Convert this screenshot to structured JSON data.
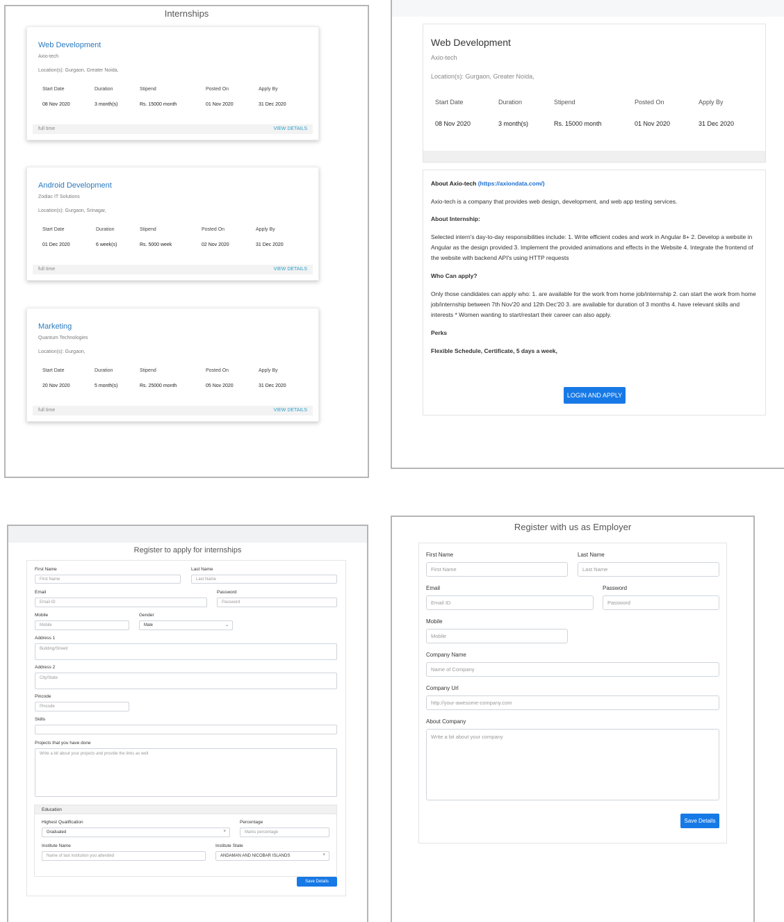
{
  "internships": {
    "title": "Internships",
    "headers": [
      "Start Date",
      "Duration",
      "Stipend",
      "Posted On",
      "Apply By"
    ],
    "cards": [
      {
        "title": "Web Development",
        "company": "Axio-tech",
        "location": "Location(s): Gurgaon, Greater Noida,",
        "start_date": "08 Nov 2020",
        "duration": "3 month(s)",
        "stipend": "Rs. 15000 month",
        "posted_on": "01 Nov 2020",
        "apply_by": "31 Dec 2020",
        "type": "full time",
        "action": "VIEW DETAILS"
      },
      {
        "title": "Android Development",
        "company": "Zodiac IT Solutions",
        "location": "Location(s): Gurgaon, Srinagar,",
        "start_date": "01 Dec 2020",
        "duration": "6 week(s)",
        "stipend": "Rs. 5000 week",
        "posted_on": "02 Nov 2020",
        "apply_by": "31 Dec 2020",
        "type": "full time",
        "action": "VIEW DETAILS"
      },
      {
        "title": "Marketing",
        "company": "Quantum Technologies",
        "location": "Location(s): Gurgaon,",
        "start_date": "20 Nov 2020",
        "duration": "5 month(s)",
        "stipend": "Rs. 25000 month",
        "posted_on": "05 Nov 2020",
        "apply_by": "31 Dec 2020",
        "type": "full time",
        "action": "VIEW DETAILS"
      }
    ]
  },
  "detail": {
    "title": "Web Development",
    "company": "Axio-tech",
    "location": "Location(s): Gurgaon, Greater Noida,",
    "headers": [
      "Start Date",
      "Duration",
      "Stipend",
      "Posted On",
      "Apply By"
    ],
    "values": [
      "08 Nov 2020",
      "3 month(s)",
      "Rs. 15000 month",
      "01 Nov 2020",
      "31 Dec 2020"
    ],
    "about_company_heading": "About Axio-tech",
    "about_company_link": "(https://axiondata.com/)",
    "about_company_text": "Axio-tech is a company that provides web design, development, and web app testing services.",
    "about_internship_heading": "About Internship:",
    "about_internship_text": "Selected intern's day-to-day responsibilities include: 1. Write efficient codes and work in Angular 8+ 2. Develop a website in Angular as the design provided 3. Implement the provided animations and effects in the Website 4. Integrate the frontend of the website with backend API's using HTTP requests",
    "who_heading": "Who Can apply?",
    "who_text": "Only those candidates can apply who: 1. are available for the work from home job/internship 2. can start the work from home job/internship between 7th Nov'20 and 12th Dec'20 3. are available for duration of 3 months 4. have relevant skills and interests * Women wanting to start/restart their career can also apply.",
    "perks_heading": "Perks",
    "perks_text": "Flexible Schedule, Certificate, 5 days a week,",
    "apply_button": "LOGIN AND APPLY"
  },
  "student_form": {
    "title": "Register to apply for internships",
    "first_name_label": "First Name",
    "first_name_placeholder": "First Name",
    "last_name_label": "Last Name",
    "last_name_placeholder": "Last Name",
    "email_label": "Email",
    "email_placeholder": "Email ID",
    "password_label": "Password",
    "password_placeholder": "Password",
    "mobile_label": "Mobile",
    "mobile_placeholder": "Mobile",
    "gender_label": "Gender",
    "gender_value": "Male",
    "address1_label": "Address 1",
    "address1_placeholder": "Building/Street/",
    "address2_label": "Address 2",
    "address2_placeholder": "City/State",
    "pincode_label": "Pincode",
    "pincode_placeholder": "Pincode",
    "skills_label": "Skills",
    "projects_label": "Projects that you have done",
    "projects_placeholder": "Write a bit about your projects and provide the links as well",
    "education_heading": "Education",
    "qualification_label": "Highest Qualification",
    "qualification_value": "Graduated",
    "percentage_label": "Percentage",
    "percentage_placeholder": "Marks percentage",
    "institute_label": "Institute Name",
    "institute_placeholder": "Name of last institution you attended",
    "state_label": "Institute State",
    "state_value": "ANDAMAN AND NICOBAR ISLANDS",
    "save_button": "Save Details"
  },
  "employer_form": {
    "title": "Register with us as Employer",
    "first_name_label": "First Name",
    "first_name_placeholder": "First Name",
    "last_name_label": "Last Name",
    "last_name_placeholder": "Last Name",
    "email_label": "Email",
    "email_placeholder": "Email ID",
    "password_label": "Password",
    "password_placeholder": "Password",
    "mobile_label": "Mobile",
    "mobile_placeholder": "Mobile",
    "company_name_label": "Company Name",
    "company_name_placeholder": "Name of Company",
    "company_url_label": "Company Url",
    "company_url_placeholder": "http://your-awesome-company.com",
    "about_label": "About Company",
    "about_placeholder": "Write a bit about your company",
    "save_button": "Save Details"
  },
  "colors": {
    "accent": "#1779e6",
    "link": "#2a7abf",
    "view_details": "#2aa0c8"
  }
}
